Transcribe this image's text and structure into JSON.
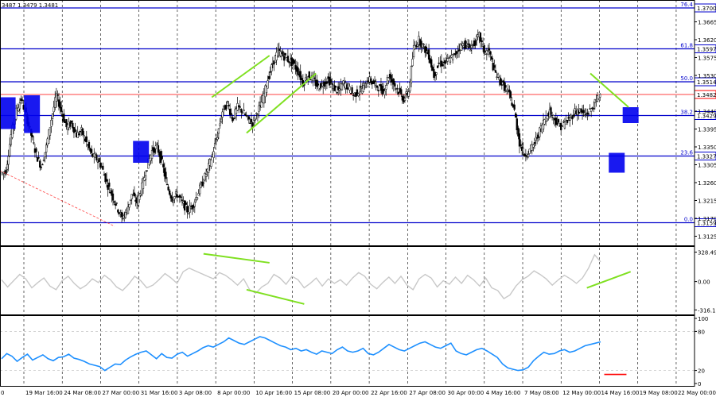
{
  "chart_data": [
    {
      "type": "candlestick",
      "title": "",
      "ohlc_readout": "3487 1.3479 1.3481",
      "ylim": [
        1.31,
        1.372
      ],
      "y_ticks": [
        1.3125,
        1.317,
        1.3215,
        1.326,
        1.3305,
        1.335,
        1.3395,
        1.344,
        1.3485,
        1.353,
        1.3575,
        1.362,
        1.3665
      ],
      "x_labels": [
        "19 Mar 16:00",
        "24 Mar 08:00",
        "27 Mar 00:00",
        "31 Mar 16:00",
        "3 Apr 08:00",
        "8 Apr 00:00",
        "10 Apr 16:00",
        "15 Apr 08:00",
        "20 Apr 00:00",
        "22 Apr 16:00",
        "27 Apr 08:00",
        "30 Apr 00:00",
        "4 May 16:00",
        "7 May 08:00",
        "12 May 00:00",
        "14 May 16:00",
        "19 May 08:00",
        "22 May 00:00"
      ],
      "x_label_first": "0",
      "fib_levels": [
        {
          "ratio": "76.4",
          "price": "1.3700",
          "y": 1.37
        },
        {
          "ratio": "61.8",
          "price": "1.3597",
          "y": 1.3597
        },
        {
          "ratio": "50.0",
          "price": "1.3514",
          "y": 1.3514
        },
        {
          "ratio": "38.2",
          "price": "1.3429",
          "y": 1.3429
        },
        {
          "ratio": "23.6",
          "price": "1.3327",
          "y": 1.3327
        },
        {
          "ratio": "0.0",
          "price": "1.3159",
          "y": 1.3159
        }
      ],
      "current_price": {
        "label": "1.3482",
        "y": 1.3482,
        "color": "#ff0000"
      },
      "close_series": [
        1.329,
        1.338,
        1.344,
        1.347,
        1.343,
        1.338,
        1.333,
        1.33,
        1.335,
        1.342,
        1.348,
        1.344,
        1.34,
        1.341,
        1.338,
        1.339,
        1.336,
        1.333,
        1.332,
        1.33,
        1.326,
        1.323,
        1.32,
        1.317,
        1.319,
        1.323,
        1.321,
        1.325,
        1.33,
        1.334,
        1.335,
        1.331,
        1.325,
        1.322,
        1.323,
        1.321,
        1.319,
        1.32,
        1.323,
        1.326,
        1.329,
        1.333,
        1.338,
        1.344,
        1.346,
        1.342,
        1.345,
        1.344,
        1.342,
        1.341,
        1.344,
        1.347,
        1.352,
        1.356,
        1.359,
        1.358,
        1.357,
        1.356,
        1.354,
        1.351,
        1.353,
        1.352,
        1.35,
        1.351,
        1.352,
        1.35,
        1.349,
        1.351,
        1.35,
        1.348,
        1.349,
        1.35,
        1.352,
        1.351,
        1.35,
        1.349,
        1.353,
        1.351,
        1.349,
        1.347,
        1.349,
        1.36,
        1.362,
        1.36,
        1.358,
        1.353,
        1.356,
        1.356,
        1.357,
        1.358,
        1.36,
        1.361,
        1.36,
        1.361,
        1.363,
        1.359,
        1.359,
        1.354,
        1.352,
        1.35,
        1.348,
        1.344,
        1.336,
        1.333,
        1.334,
        1.336,
        1.339,
        1.342,
        1.344,
        1.342,
        1.34,
        1.341,
        1.342,
        1.344,
        1.344,
        1.343,
        1.344,
        1.346,
        1.3482
      ],
      "blue_boxes": [
        {
          "t": 0.011,
          "y_top": 1.3475,
          "y_bottom": 1.3395
        },
        {
          "t": 0.046,
          "y_top": 1.348,
          "y_bottom": 1.3385
        },
        {
          "t": 0.203,
          "y_top": 1.3365,
          "y_bottom": 1.331
        },
        {
          "t": 0.888,
          "y_top": 1.3335,
          "y_bottom": 1.3285
        },
        {
          "t": 0.908,
          "y_top": 1.345,
          "y_bottom": 1.341
        }
      ],
      "trend_lines": [
        {
          "t1": 0.305,
          "y1": 1.3475,
          "t2": 0.388,
          "y2": 1.358,
          "color": "#7fe020"
        },
        {
          "t1": 0.355,
          "y1": 1.3385,
          "t2": 0.455,
          "y2": 1.3535,
          "color": "#7fe020"
        },
        {
          "t1": 0.85,
          "y1": 1.3535,
          "t2": 0.905,
          "y2": 1.345,
          "color": "#7fe020"
        }
      ],
      "dashed_trend": {
        "t1": 0.0,
        "y1": 1.329,
        "t2": 0.165,
        "y2": 1.315,
        "color": "#ff4040"
      }
    },
    {
      "type": "line",
      "title": "",
      "ylim": [
        -340,
        360
      ],
      "y_ticks": [
        328.4976,
        0.0,
        -316.127
      ],
      "y_tick_labels": [
        "328.4976",
        "0.00",
        "-316.127"
      ],
      "series": [
        {
          "values": [
            20,
            -60,
            10,
            80,
            30,
            -70,
            -10,
            40,
            -50,
            -90,
            10,
            60,
            -20,
            -80,
            -40,
            30,
            -10,
            70,
            20,
            -60,
            -100,
            -30,
            60,
            10,
            -70,
            -40,
            20,
            90,
            40,
            -20,
            110,
            150,
            120,
            90,
            60,
            30,
            100,
            70,
            20,
            -40,
            30,
            -90,
            -130,
            -60,
            -20,
            80,
            40,
            -30,
            60,
            20,
            -70,
            -20,
            40,
            -50,
            30,
            -20,
            20,
            -40,
            40,
            100,
            60,
            -30,
            -80,
            -10,
            50,
            -20,
            60,
            -40,
            -90,
            30,
            80,
            40,
            -60,
            10,
            -30,
            50,
            -20,
            70,
            20,
            -50,
            40,
            -70,
            -100,
            -190,
            -150,
            -50,
            20,
            60,
            120,
            80,
            30,
            -40,
            20,
            70,
            30,
            -20,
            40,
            150,
            300,
            220
          ]
        }
      ],
      "divergence_lines": [
        {
          "t1": 0.293,
          "y1": 310,
          "t2": 0.388,
          "y2": 210,
          "color": "#7fe020"
        },
        {
          "t1": 0.355,
          "y1": -90,
          "t2": 0.438,
          "y2": -250,
          "color": "#7fe020"
        },
        {
          "t1": 0.845,
          "y1": -70,
          "t2": 0.908,
          "y2": 110,
          "color": "#7fe020"
        }
      ]
    },
    {
      "type": "line",
      "title": "",
      "ylim": [
        0,
        100
      ],
      "y_ticks": [
        100,
        80,
        20,
        0
      ],
      "y_tick_labels": [
        "100",
        "80",
        "20",
        "0"
      ],
      "series": [
        {
          "values": [
            38,
            46,
            42,
            34,
            40,
            45,
            36,
            40,
            44,
            38,
            35,
            40,
            41,
            45,
            39,
            37,
            34,
            30,
            28,
            26,
            20,
            25,
            30,
            29,
            36,
            41,
            45,
            48,
            50,
            44,
            38,
            46,
            40,
            39,
            45,
            48,
            42,
            46,
            50,
            55,
            58,
            56,
            60,
            64,
            70,
            66,
            62,
            60,
            64,
            68,
            72,
            70,
            66,
            62,
            58,
            56,
            52,
            54,
            50,
            52,
            48,
            45,
            50,
            48,
            46,
            52,
            56,
            50,
            48,
            50,
            54,
            46,
            44,
            48,
            54,
            60,
            56,
            52,
            50,
            54,
            58,
            62,
            64,
            60,
            56,
            54,
            58,
            62,
            50,
            46,
            44,
            48,
            52,
            54,
            50,
            45,
            40,
            30,
            24,
            22,
            20,
            21,
            25,
            35,
            42,
            48,
            45,
            46,
            50,
            52,
            48,
            50,
            54,
            58,
            60,
            62,
            64
          ]
        }
      ],
      "marker_segment": {
        "t1": 0.87,
        "t2": 0.902,
        "y": 14,
        "color": "#ff0000"
      }
    }
  ]
}
